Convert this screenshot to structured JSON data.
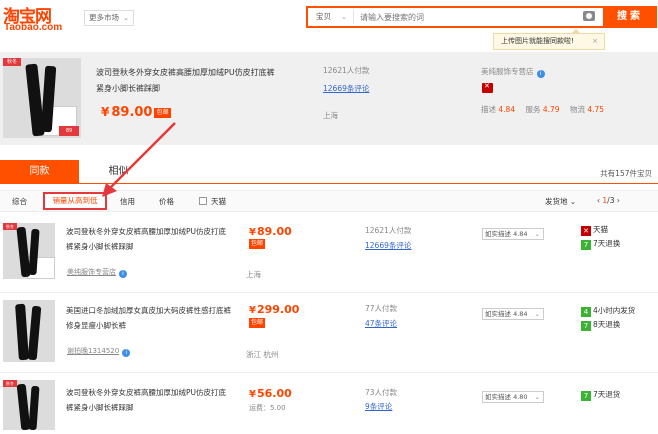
{
  "header": {
    "logo_cn": "淘宝网",
    "logo_en": "Taobao.com",
    "market": "更多市场",
    "search_category": "宝贝",
    "search_placeholder": "请输入要搜索的词",
    "search_button": "搜索",
    "tooltip": "上传图片就能搜同款啦!",
    "tooltip_close": "×"
  },
  "featured": {
    "thumb_tag": "秋冬",
    "thumb_price": "89",
    "title": "波司登秋冬外穿女皮裤高腰加厚加绒PU仿皮打底裤紧身小脚长裤踩脚",
    "price": "89.00",
    "currency": "¥",
    "shipping_badge": "包邮",
    "sales": "12621人付款",
    "reviews": "12669条评论",
    "location": "上海",
    "shop": "美纯服饰专营店",
    "ratings": [
      {
        "label": "描述",
        "value": "4.84"
      },
      {
        "label": "服务",
        "value": "4.79"
      },
      {
        "label": "物流",
        "value": "4.75"
      }
    ]
  },
  "tabs": {
    "active": "同款",
    "other": "相似",
    "total": "共有157件宝贝"
  },
  "sortbar": {
    "default": "综合",
    "sales": "销量从高到低",
    "credit": "信用",
    "price": "价格",
    "tmall": "天猫",
    "ship_from": "发货地",
    "page": "1",
    "pages": "/3",
    "prev": "‹",
    "next": "›"
  },
  "rows": [
    {
      "title": "波司登秋冬外穿女皮裤高腰加厚加绒PU仿皮打底裤紧身小脚长裤踩脚",
      "price": "89.00",
      "tag": "包邮",
      "shop": "美纯服饰专营店",
      "sales": "12621人付款",
      "reviews": "12669条评论",
      "location": "上海",
      "rating": "如实描述 4.84",
      "services": [
        {
          "icon": "tmall-icon",
          "text": "天猫"
        },
        {
          "icon": "7",
          "text": "7天退换"
        }
      ]
    },
    {
      "title": "美国进口冬加绒加厚女真皮加大码皮裤性感打底裤修身显瘦小脚长裤",
      "price": "299.00",
      "tag": "包邮",
      "shop": "谢拍晚1314520",
      "sales": "77人付款",
      "reviews": "47条评论",
      "location": "浙江 杭州",
      "rating": "如实描述 4.84",
      "services": [
        {
          "icon": "4",
          "text": "4小时内发货"
        },
        {
          "icon": "7",
          "text": "8天退换"
        }
      ]
    },
    {
      "title": "波司登秋冬外穿女皮裤高腰加厚加绒PU仿皮打底裤紧身小脚长裤踩脚",
      "price": "56.00",
      "shipping_fee": "运费：5.00",
      "sales": "73人付款",
      "reviews": "9条评论",
      "rating": "如实描述 4.80",
      "services": [
        {
          "icon": "7",
          "text": "7天退货"
        }
      ]
    }
  ],
  "colors": {
    "brand": "#ff5000",
    "price": "#ff4400",
    "highlight_border": "#e4393c",
    "link": "#3366cc"
  }
}
